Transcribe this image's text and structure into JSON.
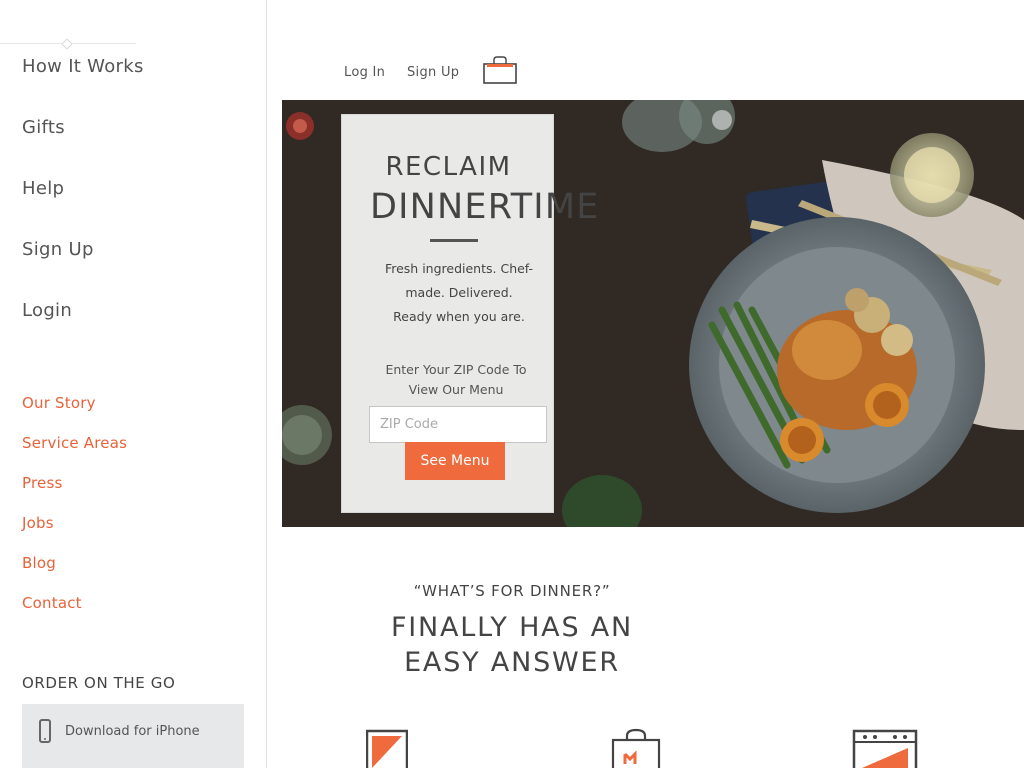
{
  "sidebar": {
    "primary_nav": [
      {
        "label": "How It Works"
      },
      {
        "label": "Gifts"
      },
      {
        "label": "Help"
      },
      {
        "label": "Sign Up"
      },
      {
        "label": "Login"
      }
    ],
    "secondary_nav": [
      {
        "label": "Our Story"
      },
      {
        "label": "Service Areas"
      },
      {
        "label": "Press"
      },
      {
        "label": "Jobs"
      },
      {
        "label": "Blog"
      },
      {
        "label": "Contact"
      }
    ],
    "order_title": "ORDER ON THE GO",
    "download_label": "Download for iPhone"
  },
  "header": {
    "login_label": "Log In",
    "signup_label": "Sign Up",
    "cart_icon": "shopping-bag-icon"
  },
  "hero": {
    "title_line1": "RECLAIM",
    "title_line2": "DINNERTIME",
    "desc_lines": [
      "Fresh ingredients. Chef-",
      "made. Delivered.",
      "Ready when you are."
    ],
    "zip_prompt_lines": [
      "Enter Your ZIP Code To",
      "View Our Menu"
    ],
    "zip_placeholder": "ZIP Code",
    "cta_label": "See Menu"
  },
  "tagline": {
    "quote": "“WHAT’S FOR DINNER?”",
    "main_lines": [
      "FINALLY HAS AN",
      "EASY ANSWER"
    ]
  },
  "feature_icons": [
    "box-icon",
    "grocery-bag-icon",
    "oven-icon"
  ],
  "colors": {
    "accent": "#e8623a",
    "button": "#ef6a3c",
    "text": "#444444",
    "download_bg": "#e6e8ea"
  }
}
